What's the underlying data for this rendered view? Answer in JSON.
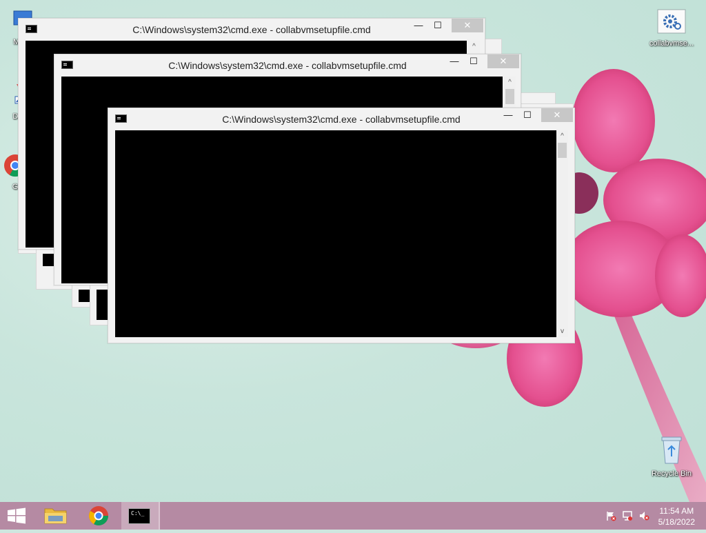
{
  "desktop": {
    "icons_left": [
      {
        "label": "My C",
        "icon": "computer-icon"
      },
      {
        "label": "Data",
        "icon": "shortcut-icon"
      },
      {
        "label": "G",
        "icon": "chrome-icon"
      }
    ],
    "icons_right": [
      {
        "label": "collabvmse...",
        "icon": "settings-file-icon"
      },
      {
        "label": "Recycle Bin",
        "icon": "recycle-bin-icon"
      }
    ]
  },
  "windows": {
    "title": "C:\\Windows\\system32\\cmd.exe - collabvmsetupfile.cmd",
    "minimize_glyph": "—",
    "maximize_glyph": "☐",
    "close_glyph": "✕",
    "scroll_up": "^",
    "scroll_down": "v"
  },
  "taskbar": {
    "time": "11:54 AM",
    "date": "5/18/2022",
    "cmd_button_text": "C:\\_"
  },
  "colors": {
    "taskbar": "#b58aa3",
    "desktop_bg": "#c9e5dc",
    "flower": "#e8559a"
  }
}
